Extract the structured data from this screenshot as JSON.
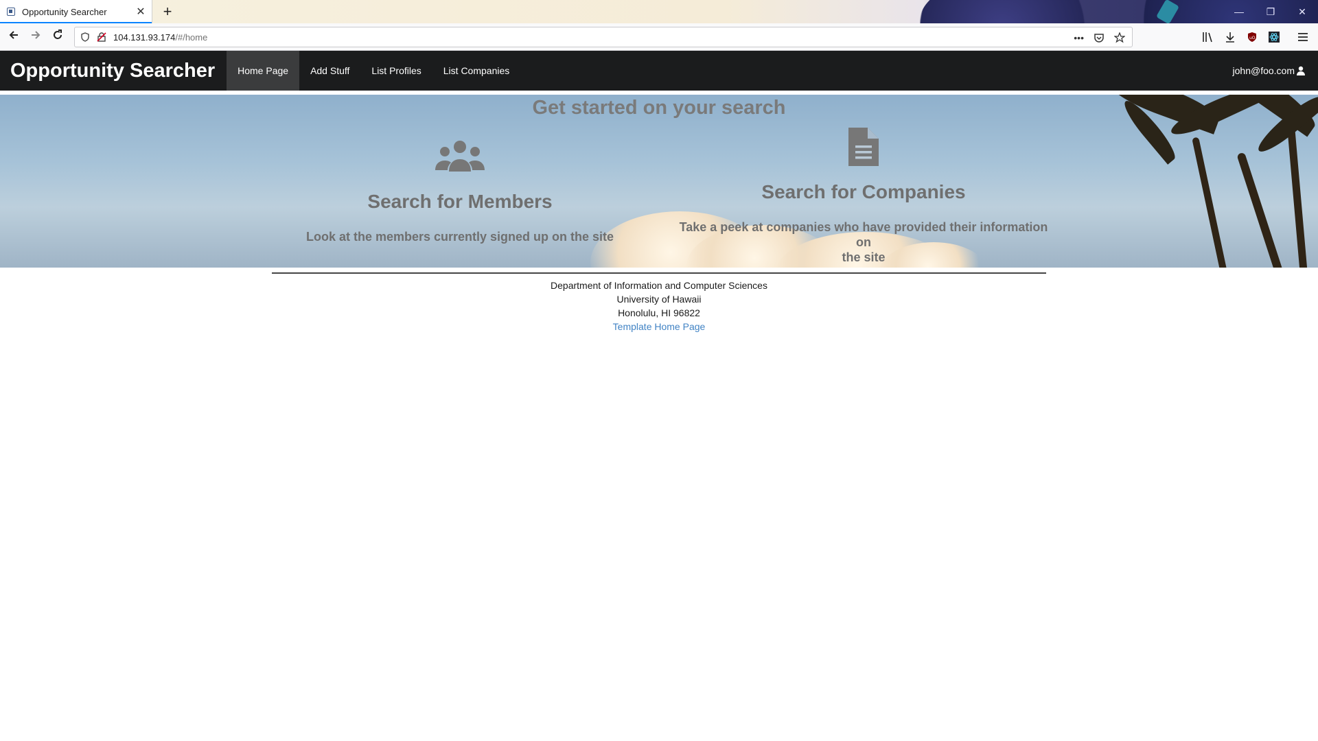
{
  "browser": {
    "tab_title": "Opportunity Searcher",
    "tab_close": "✕",
    "new_tab": "+",
    "url_host": "104.131.93.174",
    "url_path": "/#/home",
    "window_controls": [
      "—",
      "❐",
      "✕"
    ]
  },
  "app": {
    "brand": "Opportunity Searcher",
    "menu": [
      {
        "label": "Home Page",
        "active": true
      },
      {
        "label": "Add Stuff",
        "active": false
      },
      {
        "label": "List Profiles",
        "active": false
      },
      {
        "label": "List Companies",
        "active": false
      }
    ],
    "user": "john@foo.com",
    "user_icon": "user-icon"
  },
  "hero": {
    "title": "Get started on your search",
    "members": {
      "icon": "users-icon",
      "heading": "Search for Members",
      "text": "Look at the members currently signed up on the site"
    },
    "companies": {
      "icon": "file-text-icon",
      "heading": "Search for Companies",
      "text_line1": "Take a peek at companies who have provided their information on",
      "text_line2": "the site"
    }
  },
  "footer": {
    "line1": "Department of Information and Computer Sciences",
    "line2": "University of Hawaii",
    "line3": "Honolulu, HI 96822",
    "link": "Template Home Page"
  },
  "colors": {
    "navbar_bg": "#1b1c1d",
    "active_item_bg": "#3b3c3d",
    "hero_text": "#7a7a7a",
    "link": "#4183c4"
  }
}
